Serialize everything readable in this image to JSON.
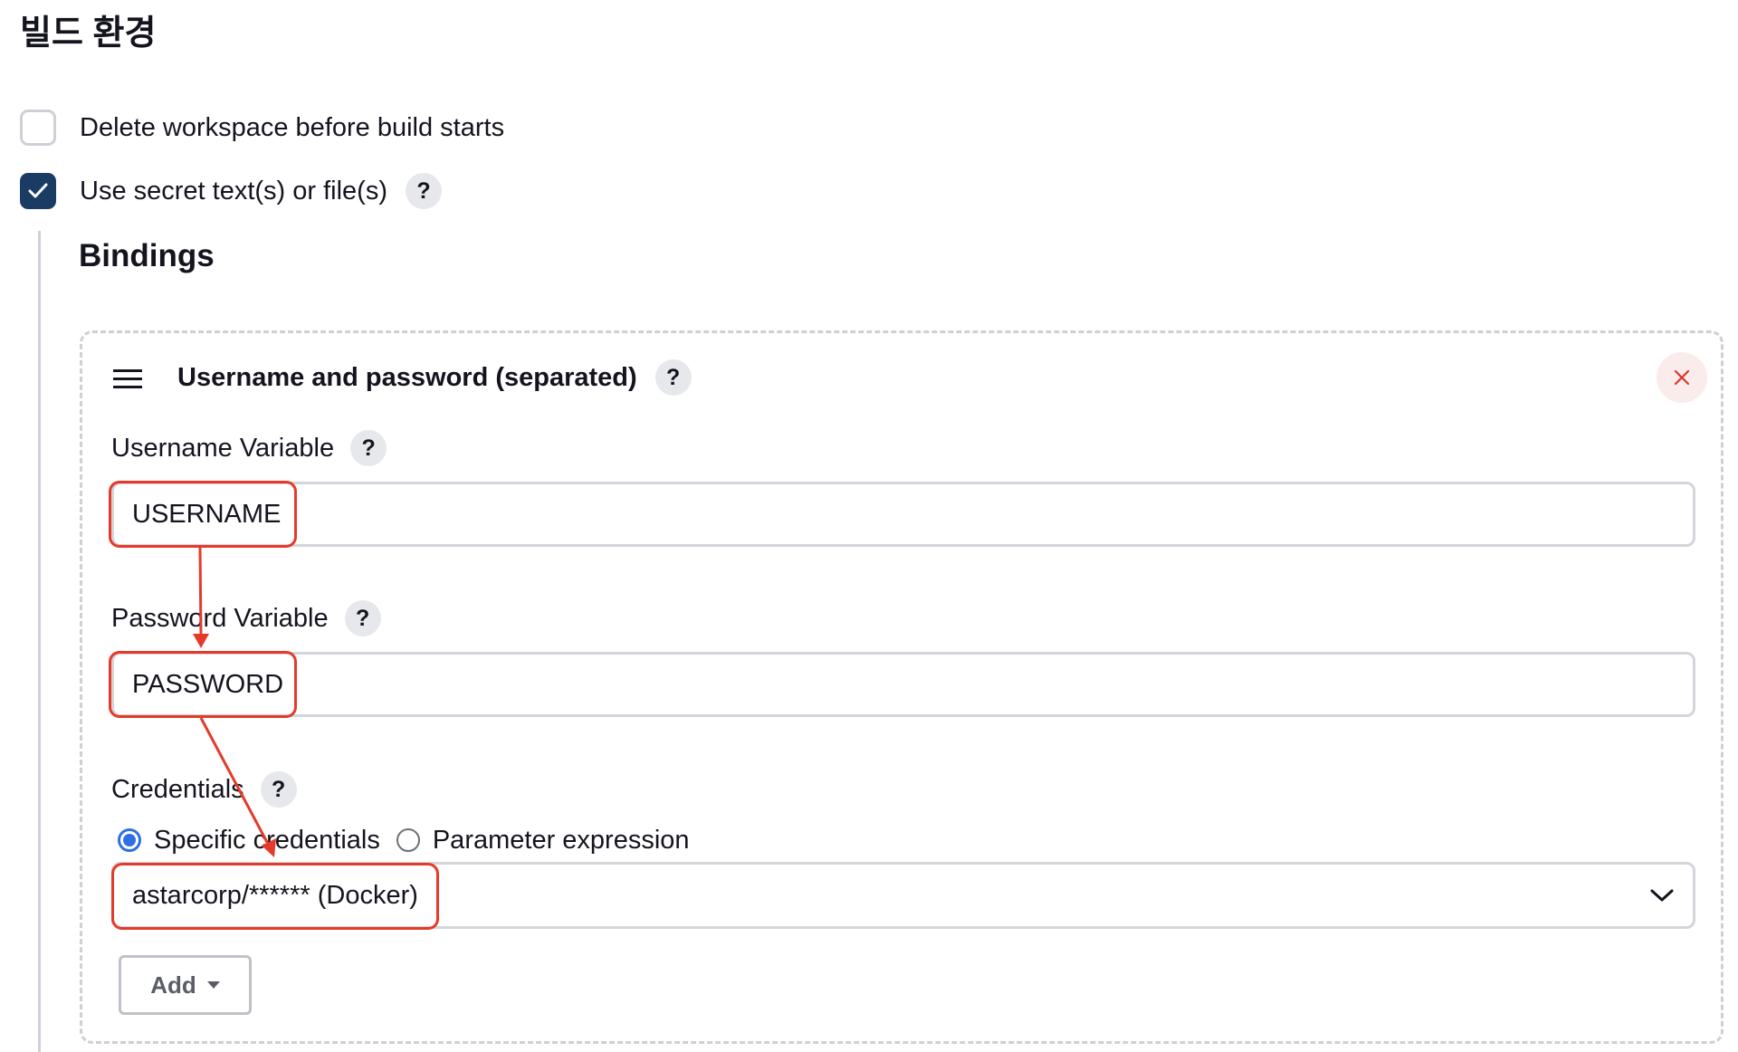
{
  "section": {
    "title": "빌드 환경"
  },
  "options": {
    "delete_workspace": {
      "label": "Delete workspace before build starts",
      "checked": false
    },
    "use_secret": {
      "label": "Use secret text(s) or file(s)",
      "checked": true,
      "help": "?"
    }
  },
  "bindings": {
    "title": "Bindings",
    "item": {
      "title": "Username and password (separated)",
      "help": "?",
      "username_variable": {
        "label": "Username Variable",
        "help": "?",
        "value": "USERNAME"
      },
      "password_variable": {
        "label": "Password Variable",
        "help": "?",
        "value": "PASSWORD"
      },
      "credentials": {
        "label": "Credentials",
        "help": "?",
        "options": [
          "Specific credentials",
          "Parameter expression"
        ],
        "selected_option": "Specific credentials",
        "selected_value": "astarcorp/****** (Docker)"
      }
    },
    "add_label": "Add"
  },
  "colors": {
    "accent": "#1a3c64",
    "radio": "#2f6fe4",
    "annotation": "#e53a2a",
    "close": "#d9362b"
  },
  "icons": [
    "check-icon",
    "help-icon",
    "drag-handle-icon",
    "close-icon",
    "chevron-down-icon",
    "caret-down-icon"
  ]
}
